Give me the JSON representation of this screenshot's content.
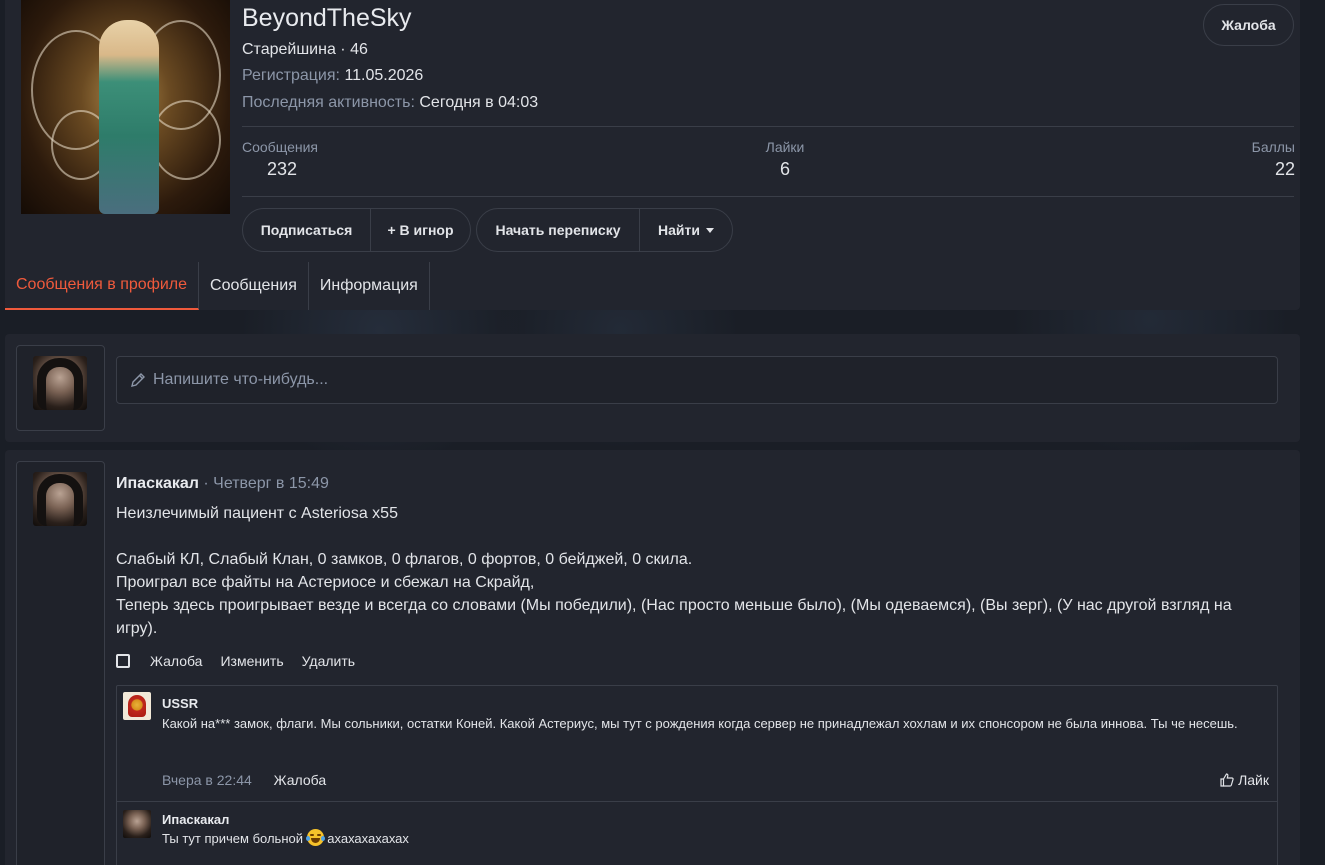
{
  "profile": {
    "username": "BeyondTheSky",
    "title": "Старейшина · 46",
    "registration_label": "Регистрация:",
    "registration_value": "11.05.2026",
    "last_activity_label": "Последняя активность:",
    "last_activity_value": "Сегодня в 04:03",
    "report_label": "Жалоба",
    "stats": [
      {
        "label": "Сообщения",
        "value": "232"
      },
      {
        "label": "Лайки",
        "value": "6"
      },
      {
        "label": "Баллы",
        "value": "22"
      }
    ],
    "buttons": {
      "subscribe": "Подписаться",
      "ignore": "+ В игнор",
      "start_conversation": "Начать переписку",
      "find": "Найти"
    }
  },
  "tabs": [
    {
      "label": "Сообщения в профиле",
      "active": true
    },
    {
      "label": "Сообщения",
      "active": false
    },
    {
      "label": "Информация",
      "active": false
    }
  ],
  "composer": {
    "placeholder": "Напишите что-нибудь..."
  },
  "post": {
    "author": "Ипаскакал",
    "separator": "·",
    "time": "Четверг в 15:49",
    "lines": [
      "Неизлечимый пациент с Asteriosa x55",
      "Слабый КЛ, Слабый Клан, 0 замков, 0 флагов, 0 фортов, 0 бейджей, 0 скила.",
      "Проиграл все файты на Астериосе и сбежал на Скрайд,",
      "Теперь здесь проигрывает везде и всегда со словами (Мы победили), (Нас просто меньше было), (Мы одеваемся), (Вы зерг), (У нас другой взгляд на игру)."
    ],
    "actions": {
      "report": "Жалоба",
      "edit": "Изменить",
      "delete": "Удалить"
    },
    "comments": [
      {
        "author": "USSR",
        "text": "Какой на*** замок, флаги. Мы сольники, остатки Коней. Какой Астериус, мы тут с рождения когда сервер не принадлежал хохлам и их спонсором не была иннова. Ты че несешь.",
        "time": "Вчера в 22:44",
        "report": "Жалоба",
        "like": "Лайк"
      },
      {
        "author": "Ипаскакал",
        "text_before": "Ты тут причем больной",
        "text_after": "ахахахахахах"
      }
    ]
  },
  "colors": {
    "accent": "#f05a3c",
    "card_bg": "#22252e",
    "page_bg": "#1b1f27",
    "muted": "#8c96a8",
    "border": "#3a3e48"
  }
}
